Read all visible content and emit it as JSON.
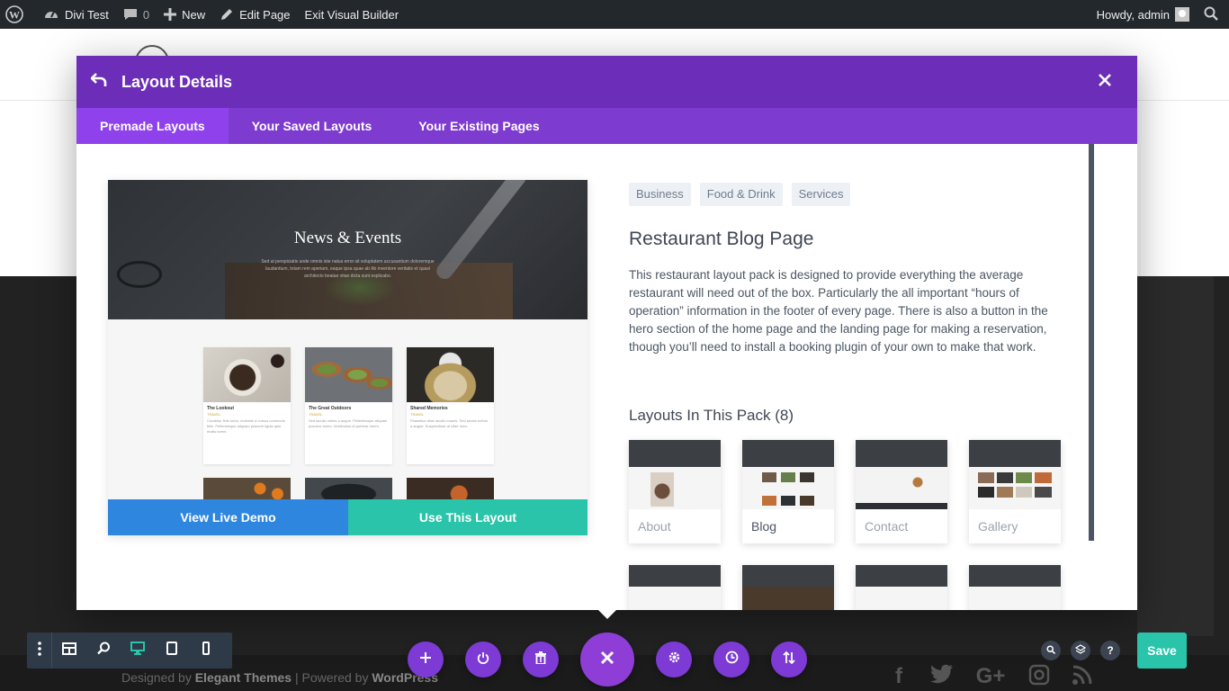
{
  "admin_bar": {
    "site_name": "Divi Test",
    "comments_count": "0",
    "new_label": "New",
    "edit_page_label": "Edit Page",
    "exit_builder_label": "Exit Visual Builder",
    "greeting": "Howdy, admin"
  },
  "modal": {
    "title": "Layout Details",
    "tabs": [
      {
        "label": "Premade Layouts",
        "active": true
      },
      {
        "label": "Your Saved Layouts",
        "active": false
      },
      {
        "label": "Your Existing Pages",
        "active": false
      }
    ],
    "preview": {
      "hero_title": "News & Events",
      "hero_text": "Sed ut perspiciatis unde omnis iste natus error sit voluptatem accusantium doloremque laudantium, totam rem aperiam, eaque ipsa quae ab illo inventore veritatis et quasi architecto beatae vitae dicta sunt explicabo.",
      "cards": [
        {
          "title": "The Lookout",
          "tag": "TRAVEL",
          "text": "Curabitur felis tortor, molestie a cursus commodo felis. Pellentesque aliquam posuere ligula quis mollis lorem."
        },
        {
          "title": "The Great Outdoors",
          "tag": "TRAVEL",
          "text": "Sed iaculis metus a augue. Pellentesque aliquam posuere lorem. Vestibulum id pulvinar lorem."
        },
        {
          "title": "Shared Memories",
          "tag": "TRAVEL",
          "text": "Phasellus vitae iaculis mauris. Sed iaculis metus a augue. Suspendisse at vitae nunc."
        }
      ],
      "view_demo_label": "View Live Demo",
      "use_layout_label": "Use This Layout"
    },
    "details": {
      "tags": [
        "Business",
        "Food & Drink",
        "Services"
      ],
      "title": "Restaurant Blog Page",
      "description": "This restaurant layout pack is designed to provide everything the average restaurant will need out of the box. Particularly the all important “hours of operation” information in the footer of every page. There is also a button in the hero section of the home page and the landing page for making a reservation, though you’ll need to install a booking plugin of your own to make that work.",
      "pack_title": "Layouts In This Pack (8)",
      "layouts": [
        {
          "label": "About"
        },
        {
          "label": "Blog"
        },
        {
          "label": "Contact"
        },
        {
          "label": "Gallery"
        }
      ]
    }
  },
  "footer": {
    "designed_by": "Designed by",
    "elegant": "Elegant Themes",
    "separator": "| Powered by",
    "wordpress": "WordPress"
  },
  "builder": {
    "save_label": "Save"
  },
  "colors": {
    "header_purple": "#6c2eb9",
    "tab_purple": "#7e3bd0",
    "blue_button": "#2e86de",
    "teal_button": "#29c4a9"
  }
}
